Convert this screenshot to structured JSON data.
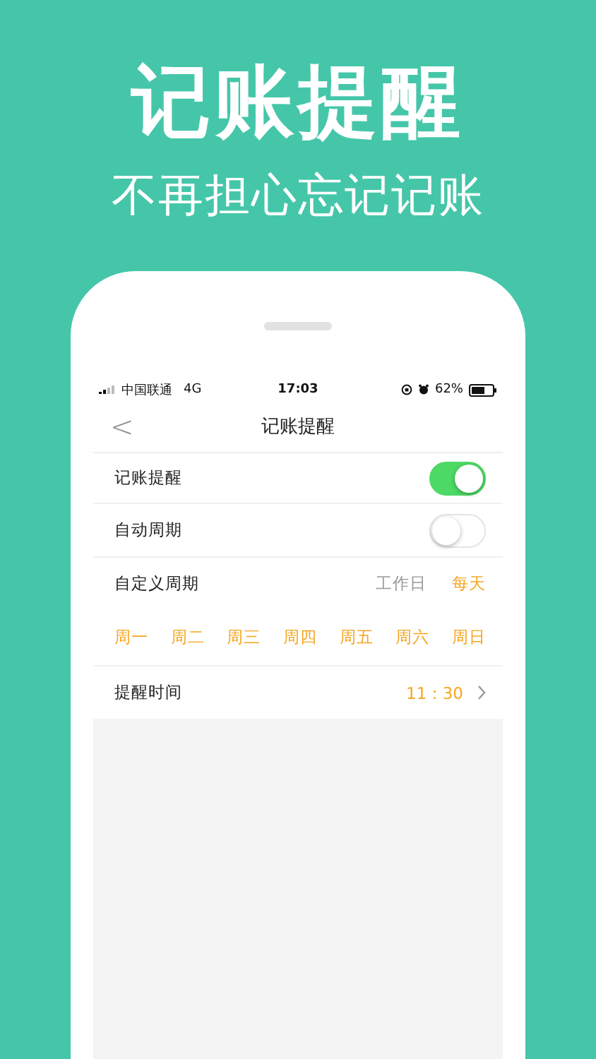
{
  "headline": "记账提醒",
  "subheadline": "不再担心忘记记账",
  "status_bar": {
    "carrier": "中国联通",
    "network": "4G",
    "time": "17:03",
    "battery": "62%"
  },
  "nav": {
    "back": "<",
    "title": "记账提醒"
  },
  "toggles": [
    {
      "label": "记账提醒",
      "on": true
    },
    {
      "label": "自动周期",
      "on": false
    }
  ],
  "cycle": {
    "label": "自定义周期",
    "options": [
      {
        "label": "工作日",
        "selected": false
      },
      {
        "label": "每天",
        "selected": true
      }
    ]
  },
  "days": [
    {
      "label": "周一",
      "selected": true
    },
    {
      "label": "周二",
      "selected": true
    },
    {
      "label": "周三",
      "selected": true
    },
    {
      "label": "周四",
      "selected": true
    },
    {
      "label": "周五",
      "selected": true
    },
    {
      "label": "周六",
      "selected": true
    },
    {
      "label": "周日",
      "selected": true
    }
  ],
  "reminder_time": {
    "label": "提醒时间",
    "value": "11 : 30"
  }
}
